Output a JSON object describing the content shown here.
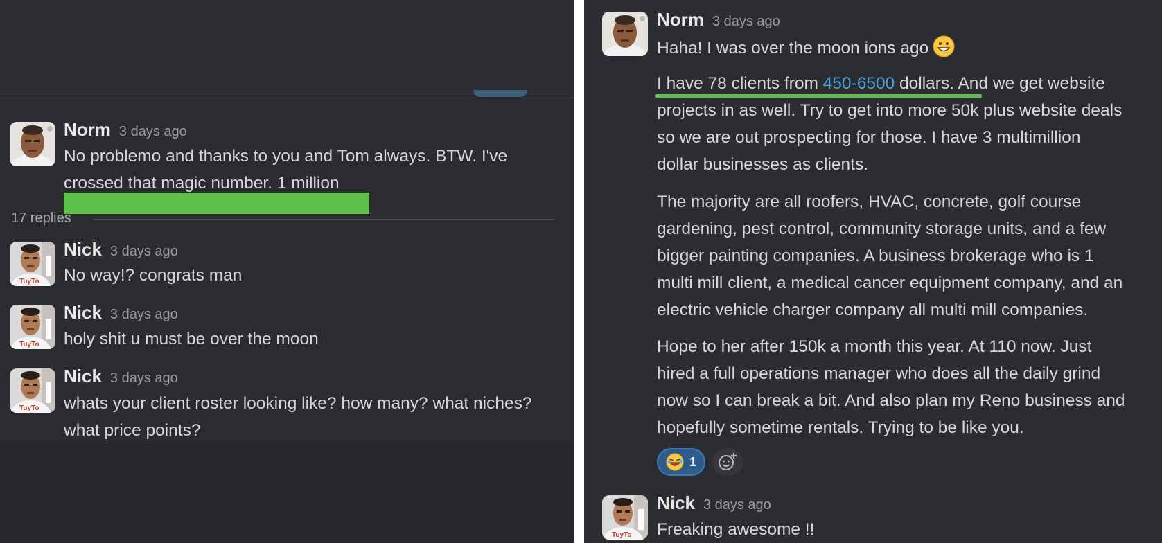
{
  "left": {
    "main_message": {
      "author": "Norm",
      "time": "3 days ago",
      "lines": [
        "No problemo and thanks to you and Tom always. BTW. I've",
        "crossed that magic number. 1 million"
      ]
    },
    "replies_label": "17 replies",
    "replies": [
      {
        "author": "Nick",
        "time": "3 days ago",
        "lines": [
          "No way!? congrats man"
        ]
      },
      {
        "author": "Nick",
        "time": "3 days ago",
        "lines": [
          "holy shit u must be over the moon"
        ]
      },
      {
        "author": "Nick",
        "time": "3 days ago",
        "lines": [
          "whats your client roster looking like? how many? what niches?",
          "what price points?"
        ]
      }
    ]
  },
  "right": {
    "message": {
      "author": "Norm",
      "time": "3 days ago",
      "first_line": "Haha! I was over the moon ions ago",
      "p1_pre": "I have 78 clients from ",
      "p1_link": "450-6500",
      "p1_post": " dollars.",
      "p1_rest": " And we get website",
      "p1_lines": [
        "projects in as well. Try to get into more 50k plus website deals",
        "so we are out prospecting for those. I have 3 multimillion",
        "dollar businesses as clients."
      ],
      "p2_lines": [
        "The majority are all roofers, HVAC, concrete, golf course",
        "gardening, pest control, community storage units, and a few",
        "bigger painting companies. A business brokerage who is 1",
        "multi mill client, a medical cancer equipment company, and an",
        "electric vehicle charger company all multi mill companies."
      ],
      "p3_lines": [
        "Hope to her after 150k a month this year. At 110 now. Just",
        "hired a full operations manager who does all the daily grind",
        "now so I can break a bit. And also plan my Reno business and",
        "hopefully sometime rentals. Trying to be like you."
      ],
      "reaction_count": "1"
    },
    "reply": {
      "author": "Nick",
      "time": "3 days ago",
      "text": "Freaking awesome !!"
    }
  },
  "icons": {
    "grin_emoji": "grinning-face-icon",
    "laugh_emoji": "rolling-on-floor-laughing-icon",
    "add_reaction": "add-reaction-icon"
  },
  "colors": {
    "highlight_green": "#5cc04a",
    "link_blue": "#4a9fd9",
    "panel_bg": "#2a2c30"
  }
}
